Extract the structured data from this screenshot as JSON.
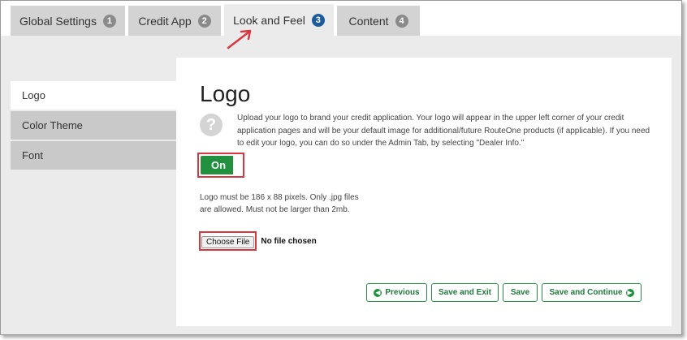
{
  "tabs": [
    {
      "label": "Global Settings",
      "badge": "1"
    },
    {
      "label": "Credit App",
      "badge": "2"
    },
    {
      "label": "Look and Feel",
      "badge": "3"
    },
    {
      "label": "Content",
      "badge": "4"
    }
  ],
  "active_tab": "Look and Feel",
  "sidebar": {
    "items": [
      {
        "label": "Logo"
      },
      {
        "label": "Color Theme"
      },
      {
        "label": "Font"
      }
    ]
  },
  "main": {
    "title": "Logo",
    "help_icon": "question-circle-icon",
    "help_glyph": "?",
    "description": "Upload your logo to brand your credit application. Your logo will appear in the upper left corner of your credit application pages and will be your default image for additional/future RouteOne products (if applicable). If you need to edit your logo, you can do so under the Admin Tab, by selecting \"Dealer Info.\"",
    "toggle_label": "On",
    "requirements": "Logo must be 186 x 88 pixels. Only .jpg files are allowed. Must not be larger than 2mb.",
    "file_button": "Choose File",
    "file_status": "No file chosen"
  },
  "actions": {
    "previous": "Previous",
    "save_exit": "Save and Exit",
    "save": "Save",
    "save_continue": "Save and Continue"
  },
  "colors": {
    "accent_green": "#219140",
    "active_badge": "#1c5c9a",
    "highlight_red": "#d9373f"
  }
}
